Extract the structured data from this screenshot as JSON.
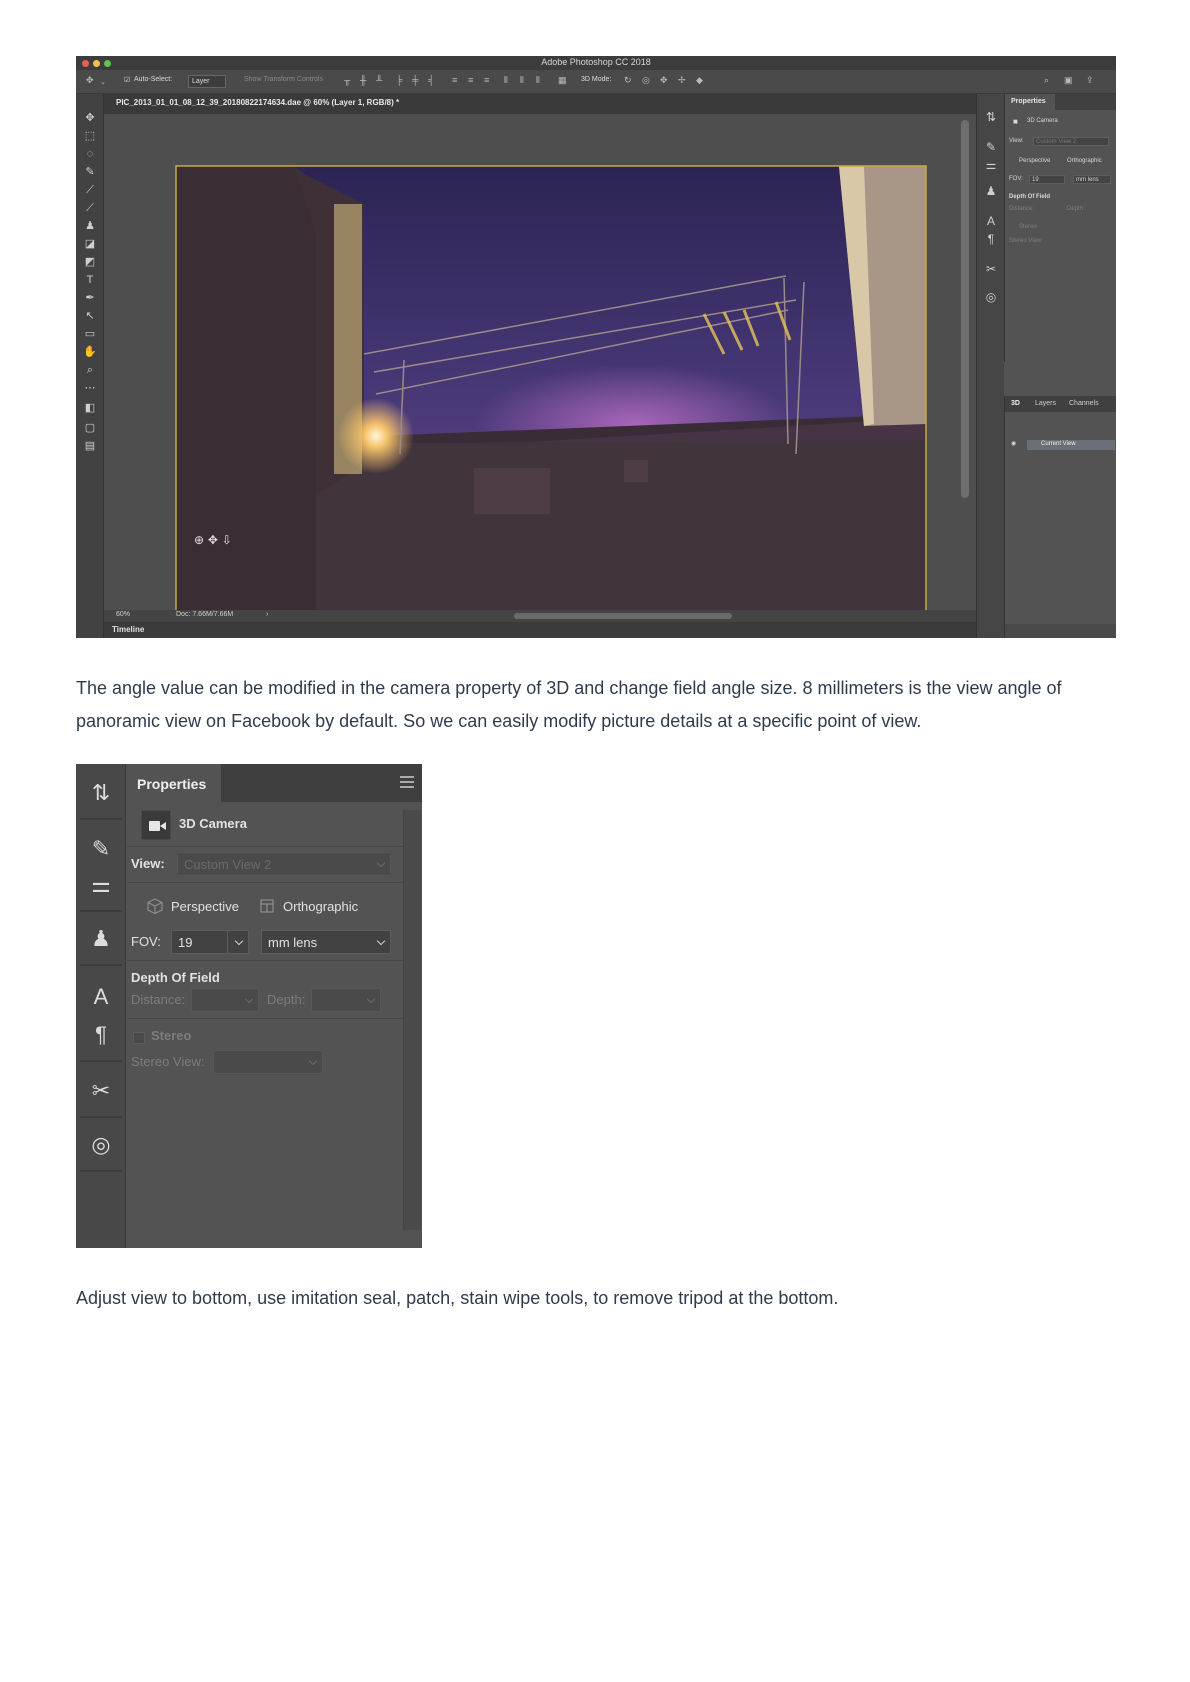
{
  "screenshot1": {
    "app_title": "Adobe Photoshop CC 2018",
    "options": {
      "auto_select_label": "Auto-Select:",
      "auto_select_value": "Layer",
      "show_transform_controls": "Show Transform Controls",
      "mode_3d_label": "3D Mode:"
    },
    "document_tab": "PIC_2013_01_01_08_12_39_20180822174634.dae @ 60% (Layer 1, RGB/8) *",
    "status": {
      "zoom": "60%",
      "doc_size": "Doc: 7.66M/7.66M",
      "arrow": "›"
    },
    "timeline_label": "Timeline",
    "properties": {
      "tab": "Properties",
      "title": "3D Camera",
      "view_label": "View:",
      "view_value": "Custom View 2",
      "perspective": "Perspective",
      "orthographic": "Orthographic",
      "fov_label": "FOV:",
      "fov_value": "19",
      "lens_value": "mm lens",
      "dof_label": "Depth Of Field",
      "distance_label": "Distance:",
      "depth_label": "Depth:",
      "stereo_label": "Stereo",
      "stereo_view_label": "Stereo View:"
    },
    "layers_panel": {
      "tabs": [
        "3D",
        "Layers",
        "Channels"
      ],
      "current_view": "Current View"
    }
  },
  "paragraph1": "The angle value can be modified in the camera property of 3D and change field angle size. 8 millimeters is the view angle of panoramic view on Facebook by default. So we can easily modify picture details at a specific point of view.",
  "screenshot2": {
    "tab": "Properties",
    "title": "3D Camera",
    "view_label": "View:",
    "view_value": "Custom View 2",
    "perspective": "Perspective",
    "orthographic": "Orthographic",
    "fov_label": "FOV:",
    "fov_value": "19",
    "lens_value": "mm lens",
    "dof_label": "Depth Of Field",
    "distance_label": "Distance:",
    "depth_label": "Depth:",
    "stereo_label": "Stereo",
    "stereo_view_label": "Stereo View:"
  },
  "paragraph2": "Adjust view to bottom, use imitation seal, patch, stain wipe tools, to remove tripod at the bottom."
}
